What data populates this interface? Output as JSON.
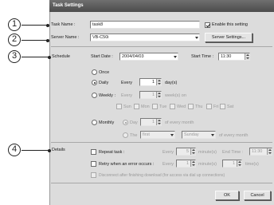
{
  "window": {
    "title": "Task Settings"
  },
  "callouts": [
    "1",
    "2",
    "3",
    "4"
  ],
  "labels": {
    "task_name": "Task Name :",
    "server_name": "Server Name :",
    "schedule": "Schedule",
    "details": "Details"
  },
  "task_name": {
    "value": "task8"
  },
  "enable": {
    "label": "Enable this setting",
    "checked": true
  },
  "server": {
    "selected": "VB-C50i",
    "settings_button": "Server Settings..."
  },
  "schedule": {
    "start_date_label": "Start Date :",
    "start_date": "2004/04/03",
    "start_time_label": "Start Time :",
    "start_time": "11:30",
    "once": "Once",
    "daily": "Daily",
    "daily_every": "Every",
    "daily_value": "1",
    "daily_unit": "day(s)",
    "weekly": "Weekly :",
    "weekly_every": "Every",
    "weekly_value": "1",
    "weekly_unit": "week(s) on",
    "days": [
      "Sun",
      "Mon",
      "Tue",
      "Wed",
      "Thu",
      "Fri",
      "Sat"
    ],
    "monthly": "Monthly",
    "day_option": "Day",
    "day_value": "1",
    "of_every_month": "of every month",
    "the_option": "The",
    "the_ordinal": "first",
    "the_weekday": "Sunday",
    "of_every_month_2": "of every month"
  },
  "details": {
    "repeat_label": "Repeat task :",
    "repeat_every": "Every",
    "repeat_value": "5",
    "repeat_unit": "minute(s)",
    "end_time_label": "End Time :",
    "end_time": "11:30",
    "retry_label": "Retry when an error occurs :",
    "retry_every": "Every",
    "retry_value": "1",
    "retry_unit": "minute(s)",
    "retry_times_value": "1",
    "retry_times_unit": "time(s)",
    "disconnect_label": "Disconnect after finishing download (for access via dial up connections)"
  },
  "buttons": {
    "ok": "OK",
    "cancel": "Cancel"
  }
}
